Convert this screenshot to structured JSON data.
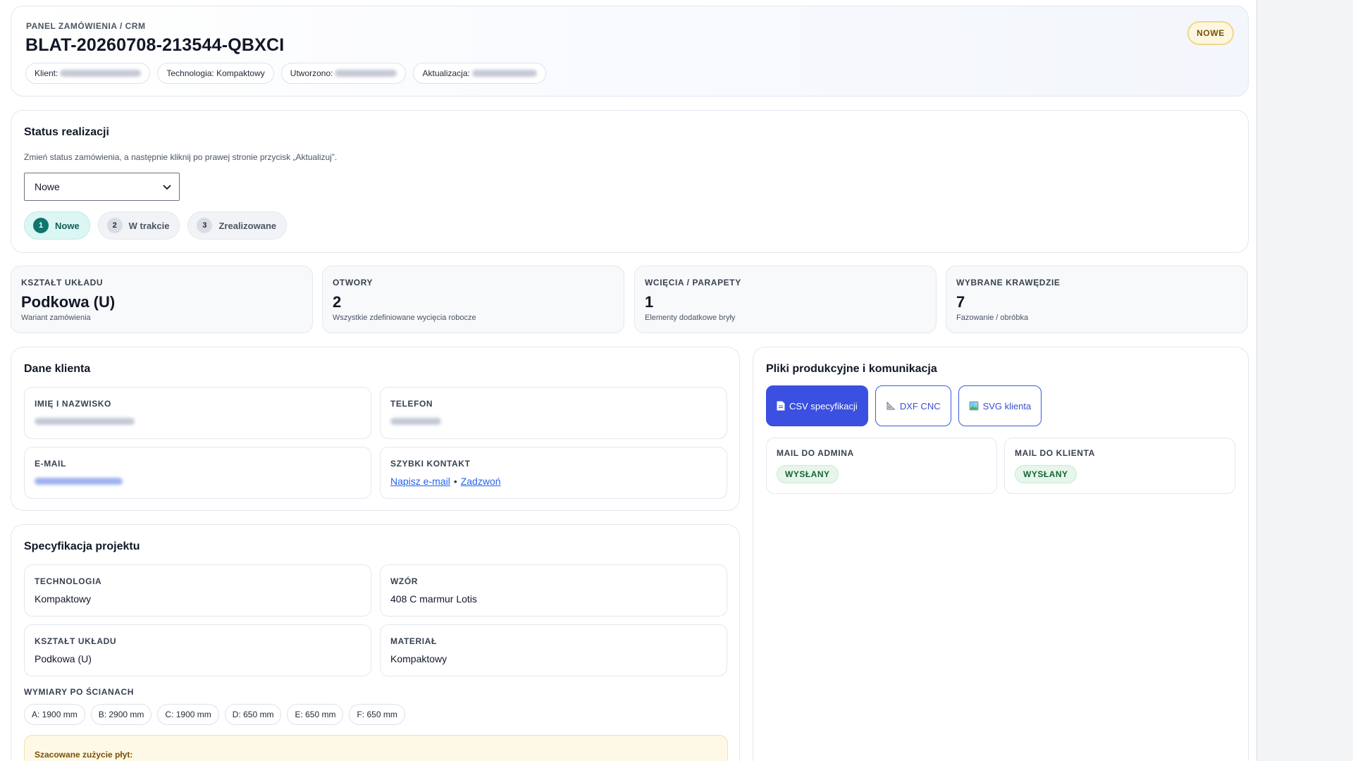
{
  "header": {
    "breadcrumb": "PANEL ZAMÓWIENIA / CRM",
    "order_id": "BLAT-20260708-213544-QBXCI",
    "status_badge": "NOWE",
    "chips": {
      "client_label": "Klient:",
      "technology": "Technologia: Kompaktowy",
      "created_label": "Utworzono:",
      "updated_label": "Aktualizacja:"
    }
  },
  "status": {
    "title": "Status realizacji",
    "hint": "Zmień status zamówienia, a następnie kliknij po prawej stronie przycisk „Aktualizuj”.",
    "selected": "Nowe",
    "steps": [
      {
        "num": "1",
        "label": "Nowe"
      },
      {
        "num": "2",
        "label": "W trakcie"
      },
      {
        "num": "3",
        "label": "Zrealizowane"
      }
    ]
  },
  "stats": [
    {
      "label": "KSZTAŁT UKŁADU",
      "value": "Podkowa (U)",
      "sub": "Wariant zamówienia"
    },
    {
      "label": "OTWORY",
      "value": "2",
      "sub": "Wszystkie zdefiniowane wycięcia robocze"
    },
    {
      "label": "WCIĘCIA / PARAPETY",
      "value": "1",
      "sub": "Elementy dodatkowe bryły"
    },
    {
      "label": "WYBRANE KRAWĘDZIE",
      "value": "7",
      "sub": "Fazowanie / obróbka"
    }
  ],
  "client": {
    "title": "Dane klienta",
    "name_label": "IMIĘ I NAZWISKO",
    "phone_label": "TELEFON",
    "email_label": "E-MAIL",
    "quick_label": "SZYBKI KONTAKT",
    "quick_email": "Napisz e-mail",
    "quick_sep": "•",
    "quick_call": "Zadzwoń"
  },
  "spec": {
    "title": "Specyfikacja projektu",
    "tech_label": "TECHNOLOGIA",
    "tech_value": "Kompaktowy",
    "pattern_label": "WZÓR",
    "pattern_value": "408 C marmur Lotis",
    "shape_label": "KSZTAŁT UKŁADU",
    "shape_value": "Podkowa (U)",
    "material_label": "MATERIAŁ",
    "material_value": "Kompaktowy",
    "dims_label": "WYMIARY PO ŚCIANACH",
    "dims": [
      "A: 1900 mm",
      "B: 2900 mm",
      "C: 1900 mm",
      "D: 650 mm",
      "E: 650 mm",
      "F: 650 mm"
    ],
    "note_title": "Szacowane zużycie płyt:"
  },
  "files": {
    "title": "Pliki produkcyjne i komunikacja",
    "csv": "CSV specyfikacji",
    "dxf": "DXF CNC",
    "svg": "SVG klienta",
    "mail_admin_label": "MAIL DO ADMINA",
    "mail_admin_status": "WYSŁANY",
    "mail_client_label": "MAIL DO KLIENTA",
    "mail_client_status": "WYSŁANY"
  },
  "colors": {
    "accent": "#3b4fe0",
    "status_active": "#0f766e",
    "success": "#166534",
    "badge_new": "#fef7e0"
  }
}
